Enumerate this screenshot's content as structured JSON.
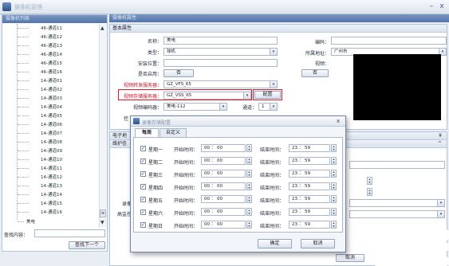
{
  "app": {
    "title": "摄像机管理",
    "minimize": "–",
    "close": "x"
  },
  "left": {
    "header": "摄像机列表",
    "tree": [
      "46-通道11",
      "46-通道12",
      "46-通道13",
      "46-通道14",
      "46-通道15",
      "46-通道16",
      "14-通道01",
      "14-通道02",
      "14-通道03",
      "14-通道04",
      "14-通道05",
      "14-通道06",
      "14-通道07",
      "14-通道08",
      "14-通道09",
      "14-通道10",
      "14-通道11",
      "14-通道12",
      "14-通道13",
      "14-通道14",
      "14-通道15",
      "14-通道16"
    ],
    "root_item": "美电",
    "search_label": "查找内容：",
    "search_value": "",
    "find_next": "查找下一个"
  },
  "right": {
    "header": "摄像机属性",
    "basic_title": "基本属性",
    "name_label": "名称：",
    "name_value": "美电",
    "type_label": "类型：",
    "type_value": "球机",
    "install_label": "安装位置：",
    "install_value": "",
    "enable_label": "是否启用：",
    "enable_value": "否",
    "forward_label": "视频转发服务器：",
    "forward_value": "GZ_VFS_65",
    "storage_label": "视频存储服务器：",
    "storage_value": "GZ_VSS_65",
    "config_button": "配置",
    "encoder_label": "视频编码器：",
    "encoder_value": "美电-112",
    "channel_label": "通道：",
    "channel_value": "1",
    "code_label": "编码：",
    "code_value": "",
    "region_label": "所属地址：",
    "region_value": "广州市",
    "video_label": "视频：",
    "video_no": "否",
    "control_label": "控",
    "sec_elec": "电子地",
    "sec_maint": "维护信",
    "rec_label": "录像",
    "alarm_label": "高监控",
    "cancel_peek": "取消"
  },
  "dialog": {
    "title": "录像存储配置",
    "close": "x",
    "tabs": [
      "每周",
      "自定义"
    ],
    "start_label": "开始时间：",
    "end_label": "结束时间：",
    "check": "✓",
    "days": [
      {
        "day": "星期一",
        "start": "00 ： 00",
        "end": "23 ： 59"
      },
      {
        "day": "星期二",
        "start": "00 ： 00",
        "end": "23 ： 59"
      },
      {
        "day": "星期三",
        "start": "00 ： 00",
        "end": "23 ： 59"
      },
      {
        "day": "星期四",
        "start": "00 ： 00",
        "end": "23 ： 59"
      },
      {
        "day": "星期五",
        "start": "00 ： 00",
        "end": "23 ： 59"
      },
      {
        "day": "星期六",
        "start": "00 ： 00",
        "end": "23 ： 59"
      },
      {
        "day": "星期日",
        "start": "00 ： 00",
        "end": "23 ： 59"
      }
    ],
    "ok": "确定",
    "cancel": "取消"
  },
  "colors": {
    "highlight": "#d21f2f",
    "header": "#5f7fb3"
  }
}
